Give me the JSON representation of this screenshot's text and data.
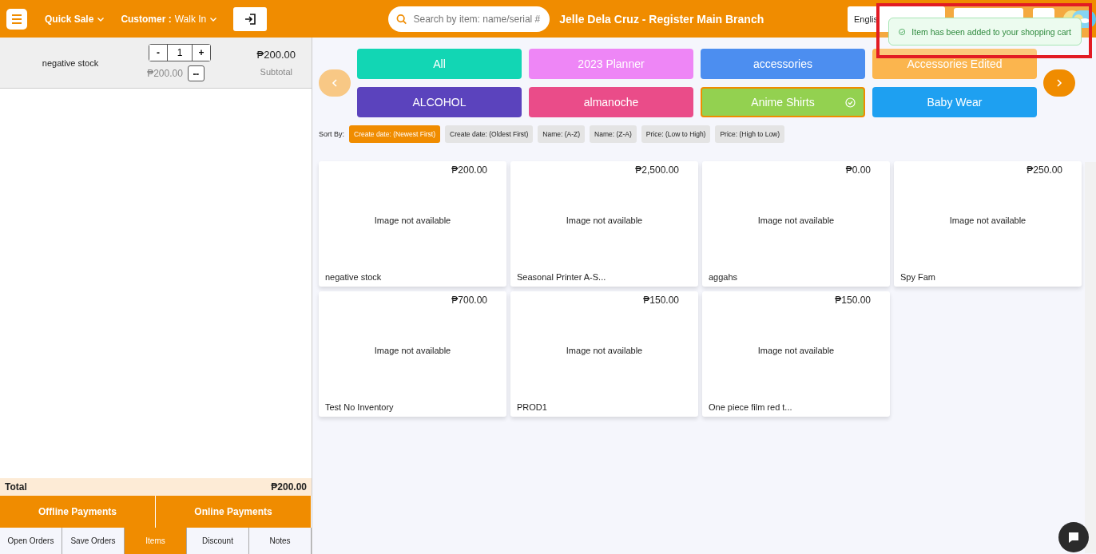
{
  "header": {
    "mode": "Quick Sale",
    "customer_label": "Customer :",
    "customer": "Walk In",
    "search": {
      "placeholder": "Search by item: name/serial #"
    },
    "title": "Jelle Dela Cruz - Register Main Branch",
    "language": "Englis"
  },
  "toast": {
    "message": "Item has been added to your shopping cart"
  },
  "cart": {
    "items": [
      {
        "name": "negative stock",
        "quantity": "1",
        "unit_price": "₱200.00",
        "amount": "₱200.00",
        "amount_label": "Subtotal",
        "minus": "-",
        "plus": "+",
        "more": "•••"
      }
    ],
    "total_label": "Total",
    "total": "₱200.00",
    "payments": [
      "Offline Payments",
      "Online Payments"
    ],
    "tabs": [
      {
        "label": "Open Orders",
        "selected": false
      },
      {
        "label": "Save Orders",
        "selected": false
      },
      {
        "label": "Items",
        "selected": true
      },
      {
        "label": "Discount",
        "selected": false
      },
      {
        "label": "Notes",
        "selected": false
      }
    ]
  },
  "categories": [
    {
      "label": "All",
      "color": "#12d6b4",
      "selected": false
    },
    {
      "label": "2023 Planner",
      "color": "#ee86f6",
      "selected": false
    },
    {
      "label": "accessories",
      "color": "#4c8ef0",
      "selected": false
    },
    {
      "label": "Accessories Edited",
      "color": "#fbb54e",
      "selected": false
    },
    {
      "label": "ALCOHOL",
      "color": "#5b43bd",
      "selected": false
    },
    {
      "label": "almanoche",
      "color": "#ea4c89",
      "selected": false
    },
    {
      "label": "Anime Shirts",
      "color": "#93d150",
      "selected": true
    },
    {
      "label": "Baby Wear",
      "color": "#1ea0f1",
      "selected": false
    }
  ],
  "sort": {
    "label": "Sort By:",
    "options": [
      {
        "label": "Create date: (Newest First)",
        "selected": true
      },
      {
        "label": "Create date: (Oldest First)",
        "selected": false
      },
      {
        "label": "Name: (A-Z)",
        "selected": false
      },
      {
        "label": "Name: (Z-A)",
        "selected": false
      },
      {
        "label": "Price: (Low to High)",
        "selected": false
      },
      {
        "label": "Price: (High to Low)",
        "selected": false
      }
    ]
  },
  "products": [
    {
      "price": "₱200.00",
      "image_text": "Image not available",
      "name": "negative stock"
    },
    {
      "price": "₱2,500.00",
      "image_text": "Image not available",
      "name": "Seasonal Printer A-S..."
    },
    {
      "price": "₱0.00",
      "image_text": "Image not available",
      "name": "aggahs"
    },
    {
      "price": "₱250.00",
      "image_text": "Image not available",
      "name": "Spy Fam"
    },
    {
      "price": "₱700.00",
      "image_text": "Image not available",
      "name": "Test No Inventory"
    },
    {
      "price": "₱150.00",
      "image_text": "Image not available",
      "name": "PROD1"
    },
    {
      "price": "₱150.00",
      "image_text": "Image not available",
      "name": "One piece film red t..."
    }
  ]
}
